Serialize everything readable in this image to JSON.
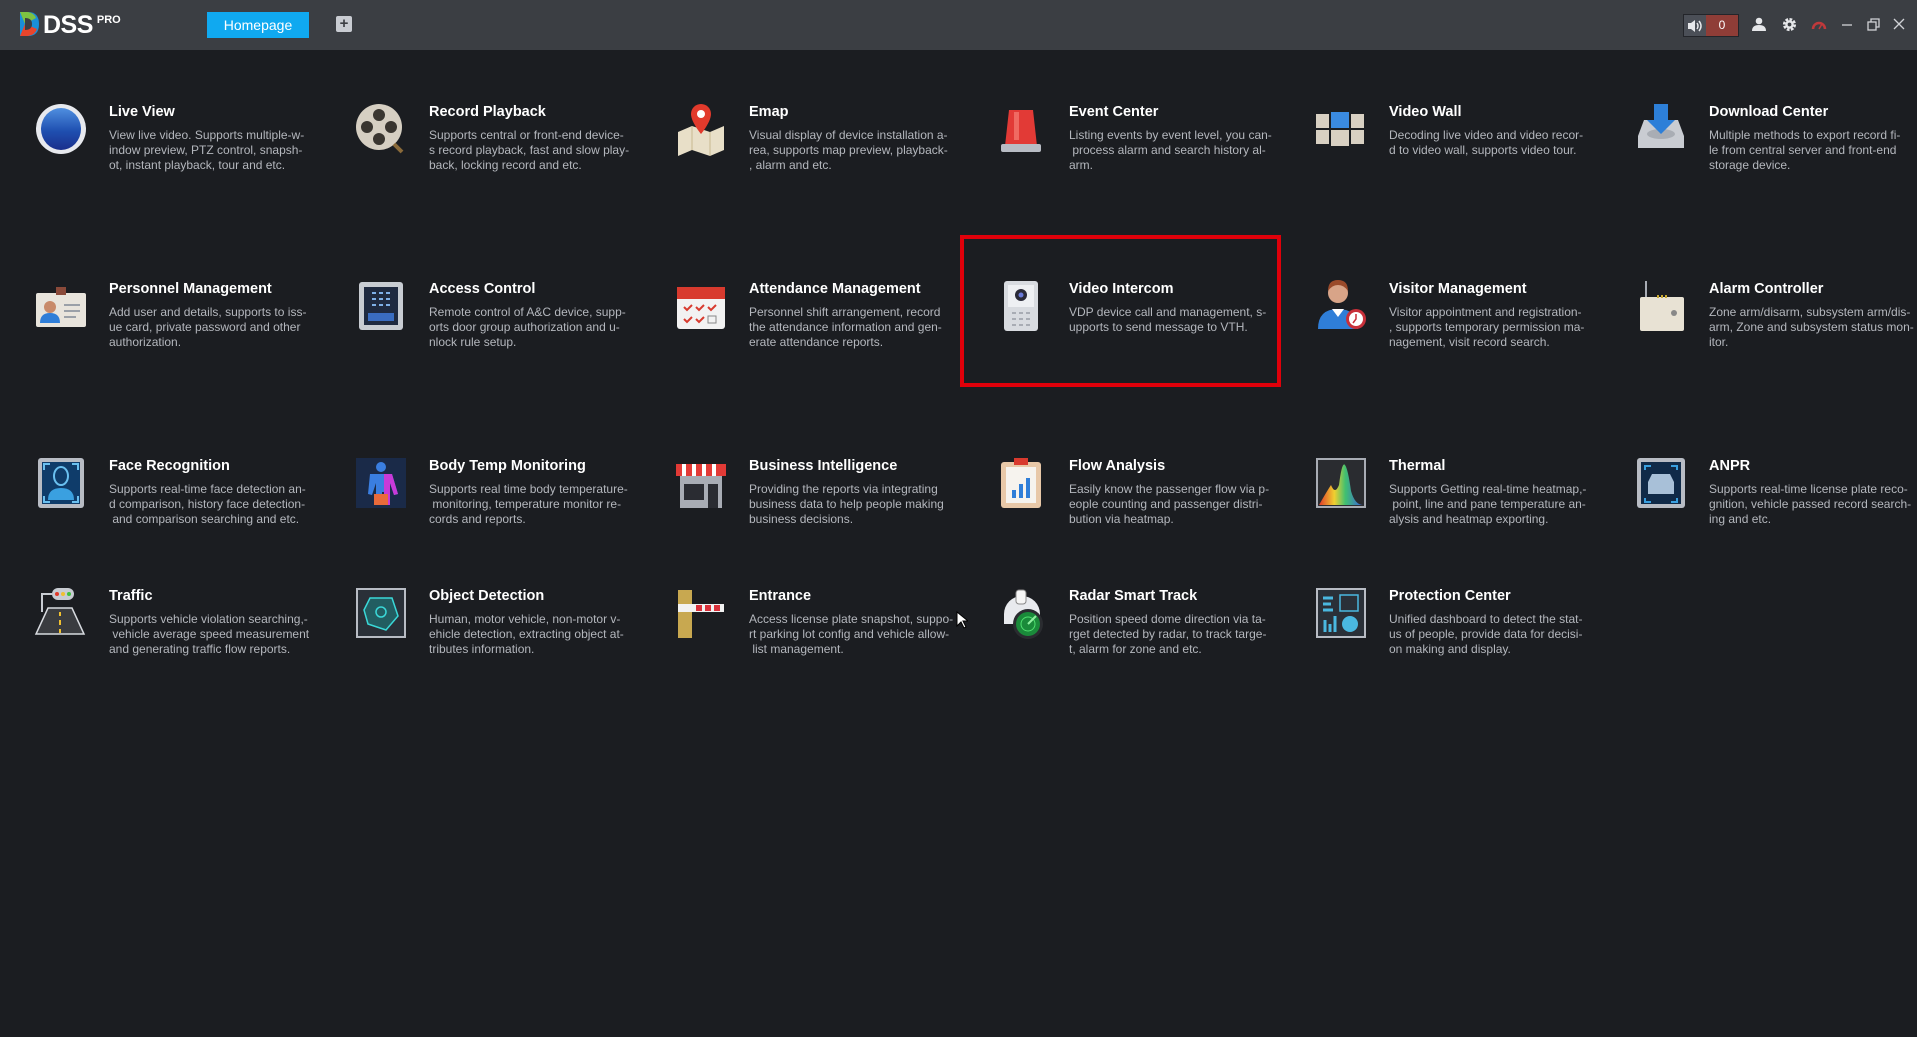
{
  "app": {
    "logo_text": "DSS",
    "logo_suffix": "PRO"
  },
  "topbar": {
    "tabs": [
      {
        "label": "Homepage",
        "active": true
      }
    ],
    "add_tab_symbol": "+",
    "alarm_count": "0",
    "icons": [
      "sound-icon",
      "user-icon",
      "settings-icon",
      "performance-gauge-icon",
      "minimize-icon",
      "restore-icon",
      "close-icon"
    ]
  },
  "colors": {
    "accent": "#10a9f0",
    "topbar": "#3b3e43",
    "background": "#1b1d21",
    "alarm": "#8f3d37",
    "highlight": "#e0000a"
  },
  "modules": [
    {
      "id": "live-view",
      "icon": "live-view-icon",
      "title": "Live View",
      "desc": [
        "View live video. Supports multiple-w-",
        "indow preview, PTZ control, snapsh-",
        "ot, instant playback, tour and etc."
      ]
    },
    {
      "id": "record-playback",
      "icon": "film-reel-icon",
      "title": "Record Playback",
      "desc": [
        "Supports central or front-end device-",
        "s record playback, fast and slow play-",
        "back, locking record and etc."
      ]
    },
    {
      "id": "emap",
      "icon": "map-pin-icon",
      "title": "Emap",
      "desc": [
        "Visual display of device installation a-",
        "rea, supports map preview, playback-",
        ", alarm and etc."
      ]
    },
    {
      "id": "event-center",
      "icon": "alarm-light-icon",
      "title": "Event Center",
      "desc": [
        "Listing events by event level, you can-",
        " process alarm and search history al-",
        "arm."
      ]
    },
    {
      "id": "video-wall",
      "icon": "video-wall-icon",
      "title": "Video Wall",
      "desc": [
        "Decoding live video and video recor-",
        "d to video wall, supports video tour."
      ]
    },
    {
      "id": "download-center",
      "icon": "download-icon",
      "title": "Download Center",
      "desc": [
        "Multiple methods to export record fi-",
        "le from central server and front-end",
        "storage device."
      ]
    },
    {
      "id": "personnel-management",
      "icon": "id-card-icon",
      "title": "Personnel Management",
      "desc": [
        "Add user and details, supports to iss-",
        "ue card, private password and other",
        "authorization."
      ]
    },
    {
      "id": "access-control",
      "icon": "keypad-icon",
      "title": "Access Control",
      "desc": [
        "Remote control of A&C device, supp-",
        "orts door group authorization and u-",
        "nlock rule setup."
      ]
    },
    {
      "id": "attendance-management",
      "icon": "calendar-icon",
      "title": "Attendance Management",
      "desc": [
        "Personnel shift arrangement, record",
        "the attendance information and gen-",
        "erate attendance reports."
      ]
    },
    {
      "id": "video-intercom",
      "icon": "intercom-icon",
      "title": "Video Intercom",
      "desc": [
        "VDP device call and management, s-",
        "upports to send message to VTH."
      ]
    },
    {
      "id": "visitor-management",
      "icon": "visitor-icon",
      "title": "Visitor Management",
      "desc": [
        "Visitor appointment and registration-",
        ", supports temporary permission ma-",
        "nagement, visit record search."
      ]
    },
    {
      "id": "alarm-controller",
      "icon": "alarm-controller-icon",
      "title": "Alarm Controller",
      "desc": [
        "Zone arm/disarm, subsystem arm/dis-",
        "arm, Zone and subsystem status mon-",
        "itor."
      ]
    },
    {
      "id": "face-recognition",
      "icon": "face-scan-icon",
      "title": "Face Recognition",
      "desc": [
        "Supports real-time face detection an-",
        "d comparison, history face detection-",
        " and comparison searching and etc."
      ]
    },
    {
      "id": "body-temp-monitoring",
      "icon": "body-temp-icon",
      "title": "Body Temp Monitoring",
      "desc": [
        "Supports real time body temperature-",
        " monitoring, temperature monitor re-",
        "cords and reports."
      ]
    },
    {
      "id": "business-intelligence",
      "icon": "store-icon",
      "title": "Business Intelligence",
      "desc": [
        "Providing the reports via integrating",
        "business data to help people making",
        "business decisions."
      ]
    },
    {
      "id": "flow-analysis",
      "icon": "clipboard-chart-icon",
      "title": "Flow Analysis",
      "desc": [
        "Easily know the passenger flow via p-",
        "eople counting and passenger distri-",
        "bution via heatmap."
      ]
    },
    {
      "id": "thermal",
      "icon": "thermal-icon",
      "title": "Thermal",
      "desc": [
        "Supports Getting real-time heatmap,-",
        " point, line and pane temperature an-",
        "alysis and heatmap exporting."
      ]
    },
    {
      "id": "anpr",
      "icon": "car-scan-icon",
      "title": "ANPR",
      "desc": [
        "Supports real-time license plate reco-",
        "gnition, vehicle passed record search-",
        "ing and etc."
      ]
    },
    {
      "id": "traffic",
      "icon": "traffic-icon",
      "title": "Traffic",
      "desc": [
        "Supports vehicle violation searching,-",
        " vehicle average speed measurement",
        "and generating traffic flow reports."
      ]
    },
    {
      "id": "object-detection",
      "icon": "object-detection-icon",
      "title": "Object Detection",
      "desc": [
        "Human, motor vehicle, non-motor v-",
        "ehicle detection, extracting object at-",
        "tributes information."
      ]
    },
    {
      "id": "entrance",
      "icon": "barrier-gate-icon",
      "title": "Entrance",
      "desc": [
        "Access license plate snapshot, suppo-",
        "rt parking lot config and vehicle allow-",
        " list management."
      ]
    },
    {
      "id": "radar-smart-track",
      "icon": "radar-icon",
      "title": "Radar Smart Track",
      "desc": [
        "Position speed dome direction via ta-",
        "rget detected by radar, to track targe-",
        "t, alarm for zone and etc."
      ]
    },
    {
      "id": "protection-center",
      "icon": "dashboard-icon",
      "title": "Protection Center",
      "desc": [
        "Unified dashboard to detect the stat-",
        "us of people, provide data for decisi-",
        "on making and display."
      ]
    }
  ],
  "highlighted_module": "video-intercom"
}
